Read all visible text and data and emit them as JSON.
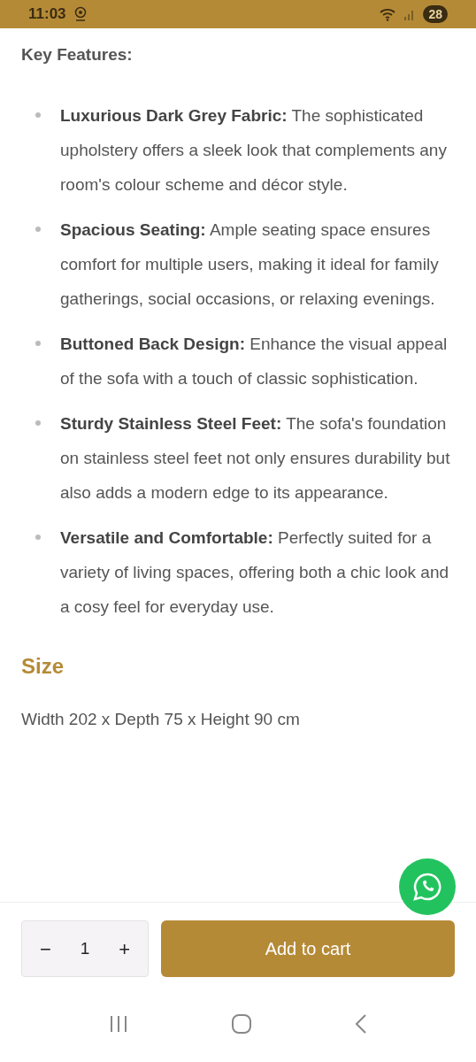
{
  "status_bar": {
    "time": "11:03",
    "battery": "28"
  },
  "heading": "Key Features:",
  "features": [
    {
      "text": "**Luxurious Dark Grey Fabric:** The sophisticated upholstery offers a sleek look that complements any room's colour scheme and décor style."
    },
    {
      "text": "**Spacious Seating:** Ample seating space ensures comfort for multiple users, making it ideal for family gatherings, social occasions, or relaxing evenings."
    },
    {
      "text": "**Buttoned Back Design:** Enhance the visual appeal of the sofa with a touch of classic sophistication."
    },
    {
      "text": "**Sturdy Stainless Steel Feet:** The sofa's foundation on stainless steel feet not only ensures durability but also adds a modern edge to its appearance."
    },
    {
      "text": "**Versatile and Comfortable:** Perfectly suited for a variety of living spaces, offering both a chic look and a cosy feel for everyday use."
    }
  ],
  "size": {
    "title": "Size",
    "dimensions": "Width 202 x Depth 75 x Height 90 cm"
  },
  "cart": {
    "decrement": "−",
    "quantity": "1",
    "increment": "+",
    "button": "Add to cart"
  }
}
